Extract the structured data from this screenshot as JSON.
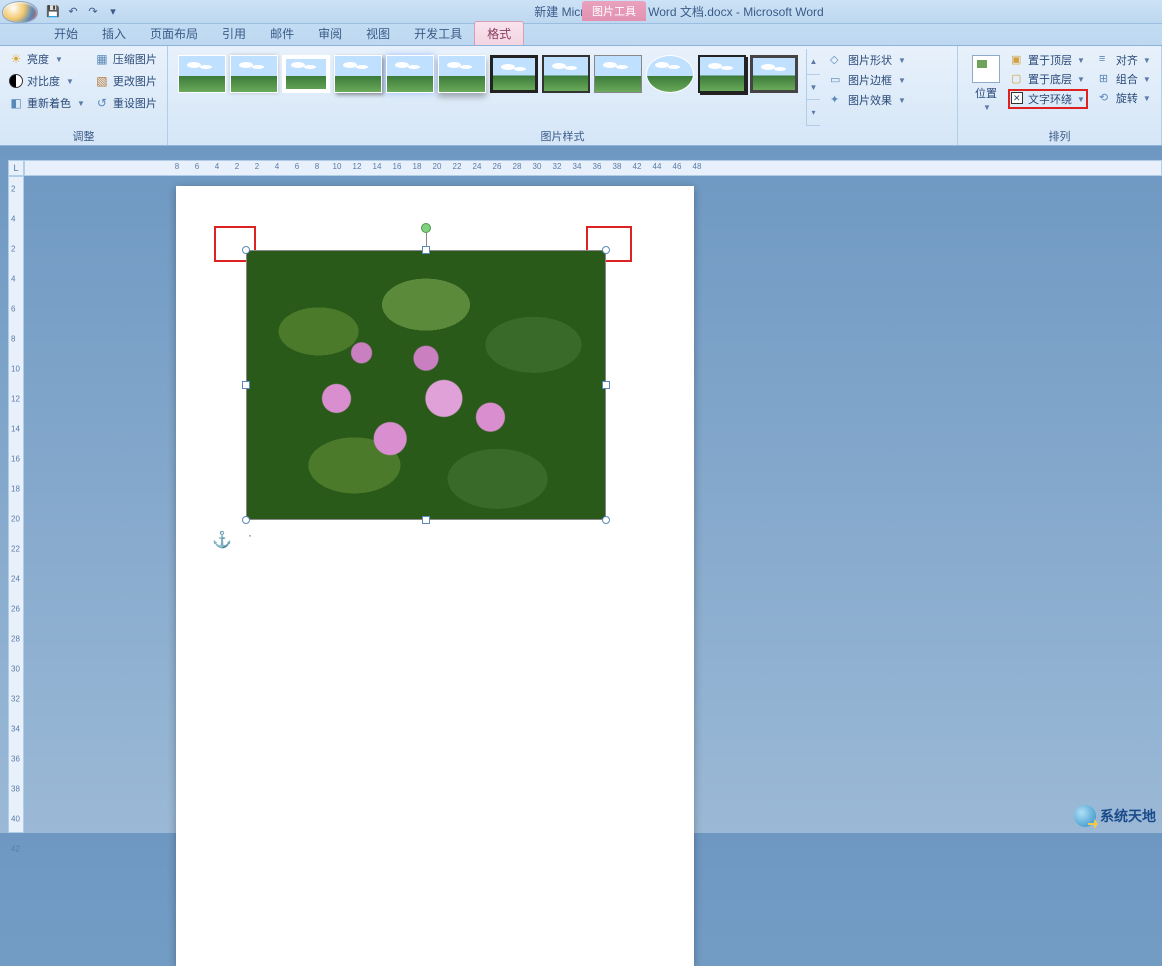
{
  "titlebar": {
    "pic_tools": "图片工具",
    "doc_title": "新建 Microsoft Office Word 文档.docx - Microsoft Word"
  },
  "tabs": {
    "start": "开始",
    "insert": "插入",
    "layout": "页面布局",
    "ref": "引用",
    "mail": "邮件",
    "review": "审阅",
    "view": "视图",
    "dev": "开发工具",
    "format": "格式"
  },
  "ribbon": {
    "adjust": {
      "brightness": "亮度",
      "contrast": "对比度",
      "recolor": "重新着色",
      "compress": "压缩图片",
      "change": "更改图片",
      "reset": "重设图片",
      "title": "调整"
    },
    "picstyles": {
      "shape": "图片形状",
      "border": "图片边框",
      "effect": "图片效果",
      "title": "图片样式"
    },
    "arrange": {
      "position": "位置",
      "front": "置于顶层",
      "back": "置于底层",
      "wrap": "文字环绕",
      "align": "对齐",
      "group": "组合",
      "rotate": "旋转",
      "title": "排列"
    }
  },
  "ruler_h": [
    "8",
    "6",
    "4",
    "2",
    "2",
    "4",
    "6",
    "8",
    "10",
    "12",
    "14",
    "16",
    "18",
    "20",
    "22",
    "24",
    "26",
    "28",
    "30",
    "32",
    "34",
    "36",
    "38",
    "42",
    "44",
    "46",
    "48"
  ],
  "ruler_v": [
    "2",
    "4",
    "2",
    "4",
    "6",
    "8",
    "10",
    "12",
    "14",
    "16",
    "18",
    "20",
    "22",
    "24",
    "26",
    "28",
    "30",
    "32",
    "34",
    "36",
    "38",
    "40",
    "42"
  ],
  "ruler_corner": "L",
  "anchor_glyph": "⚓",
  "watermark": "系统天地"
}
